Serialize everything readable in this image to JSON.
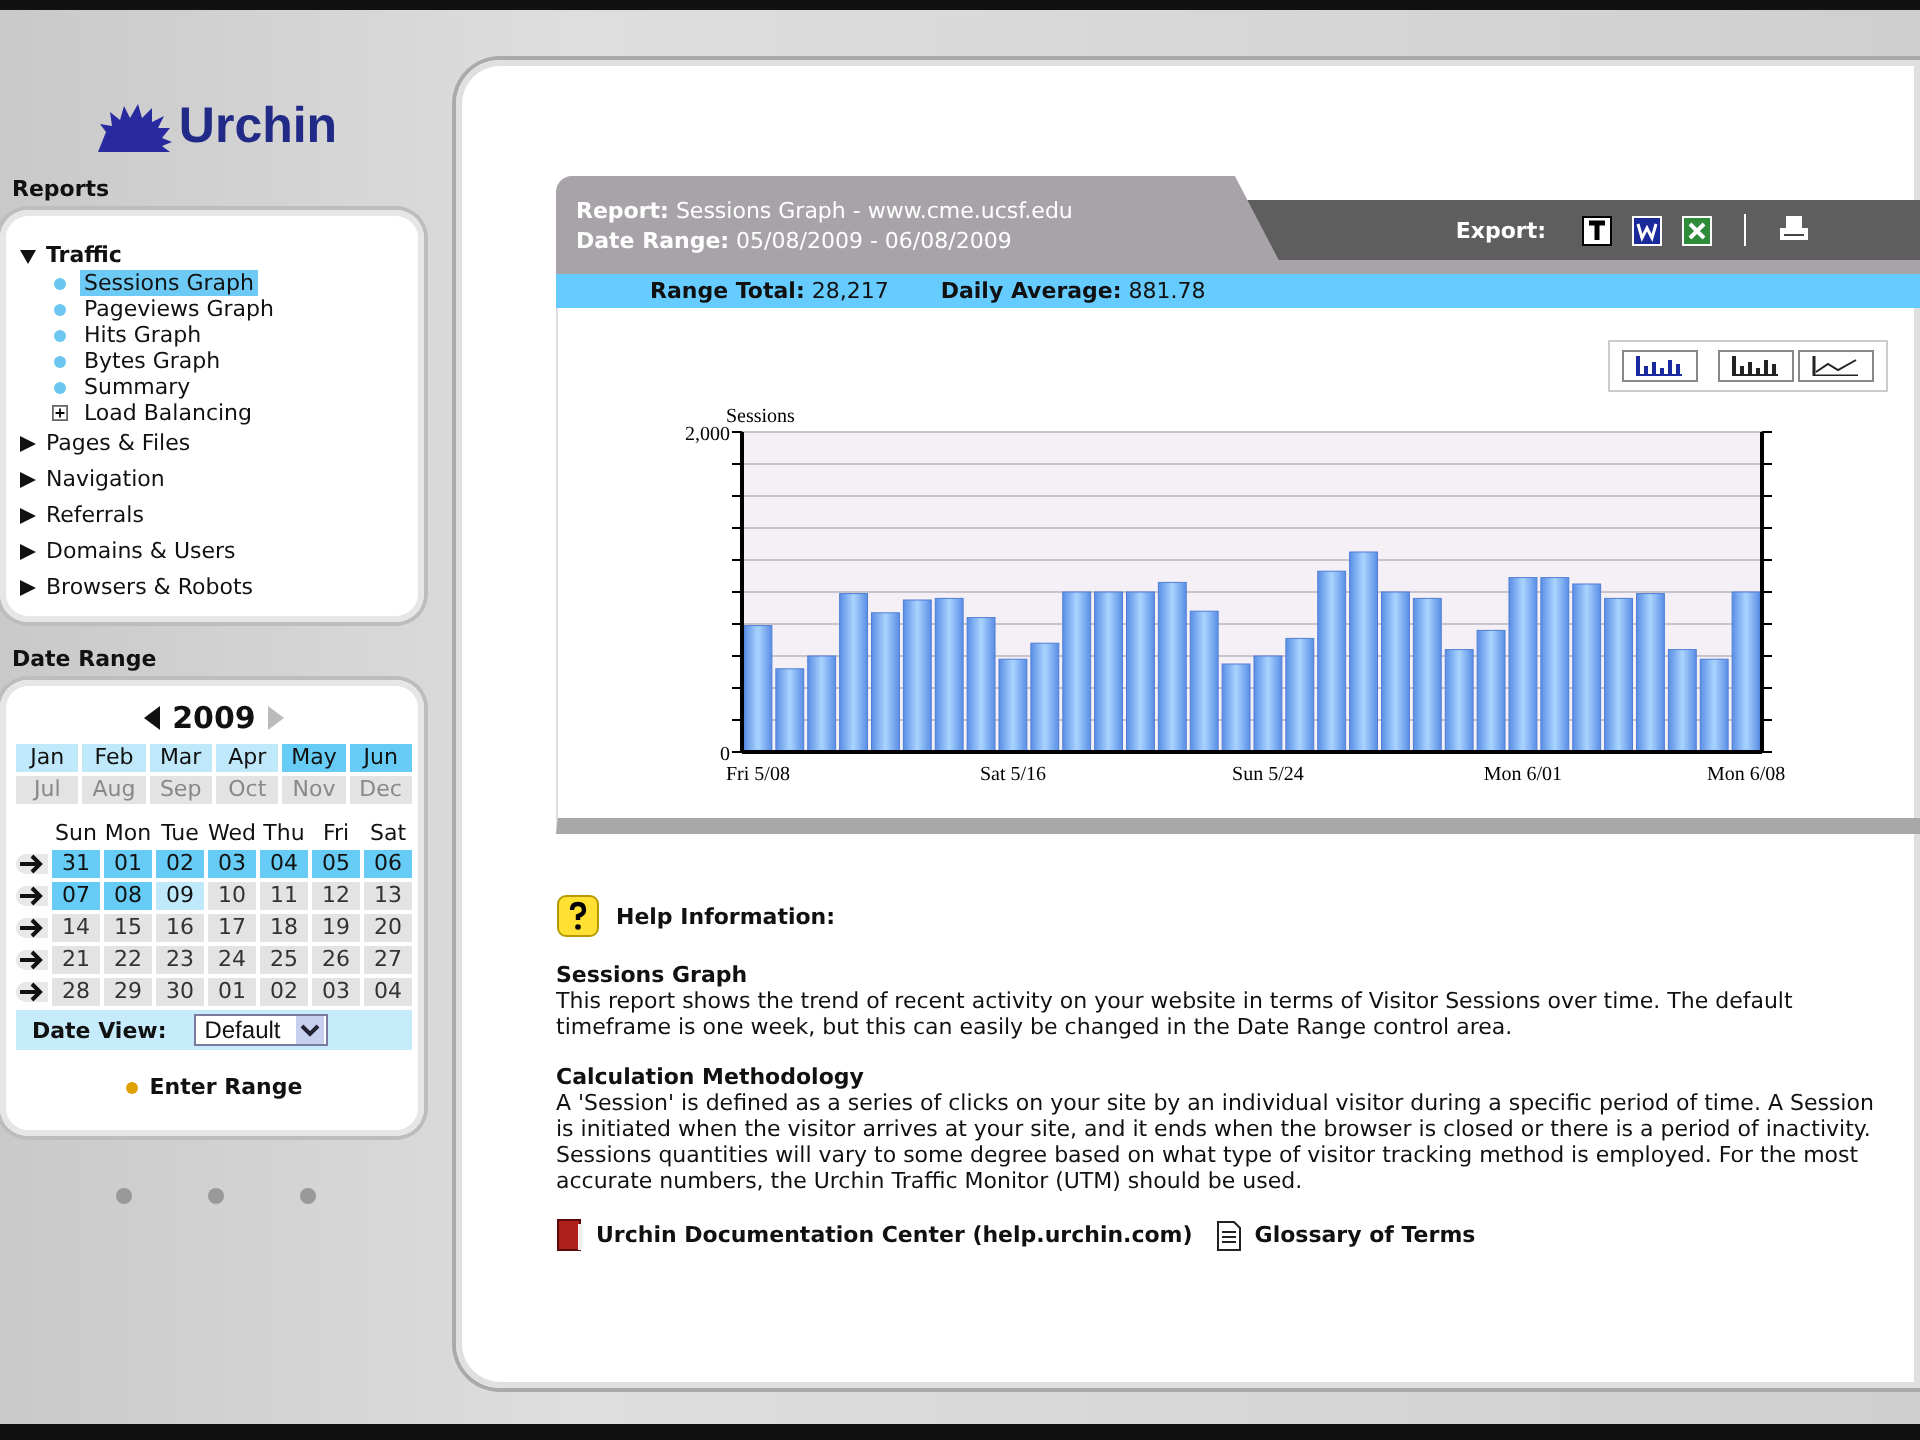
{
  "logo": {
    "text": "Urchin"
  },
  "reports": {
    "title": "Reports",
    "items": [
      {
        "label": "Traffic",
        "expanded": true,
        "children": [
          {
            "label": "Sessions Graph",
            "kind": "bullet",
            "selected": true
          },
          {
            "label": "Pageviews Graph",
            "kind": "bullet",
            "selected": false
          },
          {
            "label": "Hits Graph",
            "kind": "bullet",
            "selected": false
          },
          {
            "label": "Bytes Graph",
            "kind": "bullet",
            "selected": false
          },
          {
            "label": "Summary",
            "kind": "bullet",
            "selected": false
          },
          {
            "label": "Load Balancing",
            "kind": "plus",
            "selected": false
          }
        ]
      },
      {
        "label": "Pages & Files",
        "expanded": false
      },
      {
        "label": "Navigation",
        "expanded": false
      },
      {
        "label": "Referrals",
        "expanded": false
      },
      {
        "label": "Domains & Users",
        "expanded": false
      },
      {
        "label": "Browsers & Robots",
        "expanded": false
      }
    ]
  },
  "date_range": {
    "title": "Date Range",
    "year": "2009",
    "months": [
      {
        "label": "Jan",
        "selected": false,
        "disabled": false
      },
      {
        "label": "Feb",
        "selected": false,
        "disabled": false
      },
      {
        "label": "Mar",
        "selected": false,
        "disabled": false
      },
      {
        "label": "Apr",
        "selected": false,
        "disabled": false
      },
      {
        "label": "May",
        "selected": true,
        "disabled": false
      },
      {
        "label": "Jun",
        "selected": true,
        "disabled": false
      },
      {
        "label": "Jul",
        "selected": false,
        "disabled": true
      },
      {
        "label": "Aug",
        "selected": false,
        "disabled": true
      },
      {
        "label": "Sep",
        "selected": false,
        "disabled": true
      },
      {
        "label": "Oct",
        "selected": false,
        "disabled": true
      },
      {
        "label": "Nov",
        "selected": false,
        "disabled": true
      },
      {
        "label": "Dec",
        "selected": false,
        "disabled": true
      }
    ],
    "weekdays": [
      "Sun",
      "Mon",
      "Tue",
      "Wed",
      "Thu",
      "Fri",
      "Sat"
    ],
    "weeks": [
      [
        {
          "day": "31",
          "selected": true,
          "disabled": false
        },
        {
          "day": "01",
          "selected": true,
          "disabled": false
        },
        {
          "day": "02",
          "selected": true,
          "disabled": false
        },
        {
          "day": "03",
          "selected": true,
          "disabled": false
        },
        {
          "day": "04",
          "selected": true,
          "disabled": false
        },
        {
          "day": "05",
          "selected": true,
          "disabled": false
        },
        {
          "day": "06",
          "selected": true,
          "disabled": false
        }
      ],
      [
        {
          "day": "07",
          "selected": true,
          "disabled": false
        },
        {
          "day": "08",
          "selected": true,
          "disabled": false
        },
        {
          "day": "09",
          "selected": false,
          "disabled": false
        },
        {
          "day": "10",
          "selected": false,
          "disabled": true
        },
        {
          "day": "11",
          "selected": false,
          "disabled": true
        },
        {
          "day": "12",
          "selected": false,
          "disabled": true
        },
        {
          "day": "13",
          "selected": false,
          "disabled": true
        }
      ],
      [
        {
          "day": "14",
          "selected": false,
          "disabled": true
        },
        {
          "day": "15",
          "selected": false,
          "disabled": true
        },
        {
          "day": "16",
          "selected": false,
          "disabled": true
        },
        {
          "day": "17",
          "selected": false,
          "disabled": true
        },
        {
          "day": "18",
          "selected": false,
          "disabled": true
        },
        {
          "day": "19",
          "selected": false,
          "disabled": true
        },
        {
          "day": "20",
          "selected": false,
          "disabled": true
        }
      ],
      [
        {
          "day": "21",
          "selected": false,
          "disabled": true
        },
        {
          "day": "22",
          "selected": false,
          "disabled": true
        },
        {
          "day": "23",
          "selected": false,
          "disabled": true
        },
        {
          "day": "24",
          "selected": false,
          "disabled": true
        },
        {
          "day": "25",
          "selected": false,
          "disabled": true
        },
        {
          "day": "26",
          "selected": false,
          "disabled": true
        },
        {
          "day": "27",
          "selected": false,
          "disabled": true
        }
      ],
      [
        {
          "day": "28",
          "selected": false,
          "disabled": true
        },
        {
          "day": "29",
          "selected": false,
          "disabled": true
        },
        {
          "day": "30",
          "selected": false,
          "disabled": true
        },
        {
          "day": "01",
          "selected": false,
          "disabled": true
        },
        {
          "day": "02",
          "selected": false,
          "disabled": true
        },
        {
          "day": "03",
          "selected": false,
          "disabled": true
        },
        {
          "day": "04",
          "selected": false,
          "disabled": true
        }
      ]
    ],
    "date_view_label": "Date View:",
    "date_view_value": "Default",
    "enter_range": "Enter Range"
  },
  "report": {
    "report_label": "Report:",
    "report_value": "Sessions Graph - www.cme.ucsf.edu",
    "range_label": "Date Range:",
    "range_value": "05/08/2009 - 06/08/2009",
    "export_label": "Export:",
    "total_label": "Range Total:",
    "total_value": "28,217",
    "average_label": "Daily Average:",
    "average_value": "881.78",
    "chart_types": [
      {
        "kind": "bar",
        "selected": true
      },
      {
        "kind": "bar",
        "selected": false
      },
      {
        "kind": "line",
        "selected": false
      }
    ],
    "chart_data": {
      "type": "bar",
      "ylabel": "Sessions",
      "ylim": [
        0,
        2000
      ],
      "yticks": [
        0,
        {
          "value": 2000,
          "label": "2,000"
        }
      ],
      "categories": [
        "Fri 5/08",
        null,
        null,
        null,
        null,
        null,
        null,
        null,
        "Sat 5/16",
        null,
        null,
        null,
        null,
        null,
        null,
        null,
        "Sun 5/24",
        null,
        null,
        null,
        null,
        null,
        null,
        null,
        "Mon 6/01",
        null,
        null,
        null,
        null,
        null,
        null,
        "Mon 6/08"
      ],
      "values": [
        790,
        520,
        600,
        990,
        870,
        950,
        960,
        840,
        580,
        680,
        1000,
        1000,
        1000,
        1060,
        880,
        550,
        600,
        710,
        1130,
        1250,
        1000,
        960,
        640,
        760,
        1090,
        1090,
        1050,
        960,
        990,
        640,
        580,
        1000
      ]
    }
  },
  "help": {
    "title": "Help Information:",
    "sections": [
      {
        "heading": "Sessions Graph",
        "text": "This report shows the trend of recent activity on your website in terms of Visitor Sessions over time. The default timeframe is one week, but this can easily be changed in the Date Range control area."
      },
      {
        "heading": "Calculation Methodology",
        "text": "A 'Session' is defined as a series of clicks on your site by an individual visitor during a specific period of time. A Session is initiated when the visitor arrives at your site, and it ends when the browser is closed or there is a period of inactivity. Sessions quantities will vary to some degree based on what type of visitor tracking method is employed. For the most accurate numbers, the Urchin Traffic Monitor (UTM) should be used."
      }
    ],
    "links": [
      {
        "label": "Urchin Documentation Center (help.urchin.com)",
        "kind": "book"
      },
      {
        "label": "Glossary of Terms",
        "kind": "document"
      }
    ]
  }
}
